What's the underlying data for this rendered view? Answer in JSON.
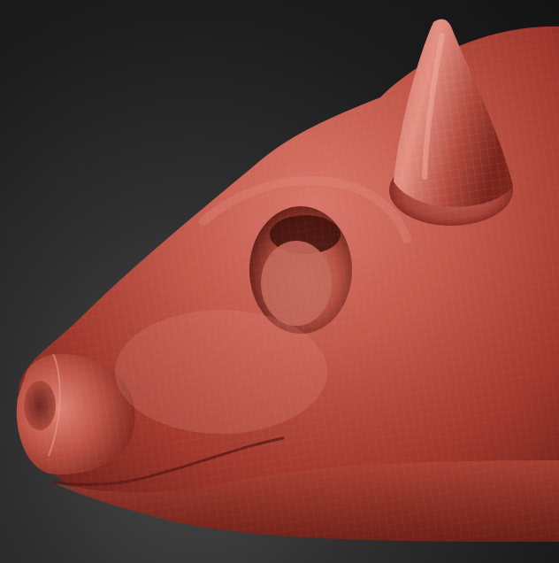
{
  "viewport": {
    "model_label": "",
    "material_color": "#b5463a",
    "highlight_color": "#e28a7c",
    "shadow_color": "#5a1a14",
    "background_color": "#1e1e1e"
  },
  "icons": {
    "model": "sculpt-model-icon"
  }
}
